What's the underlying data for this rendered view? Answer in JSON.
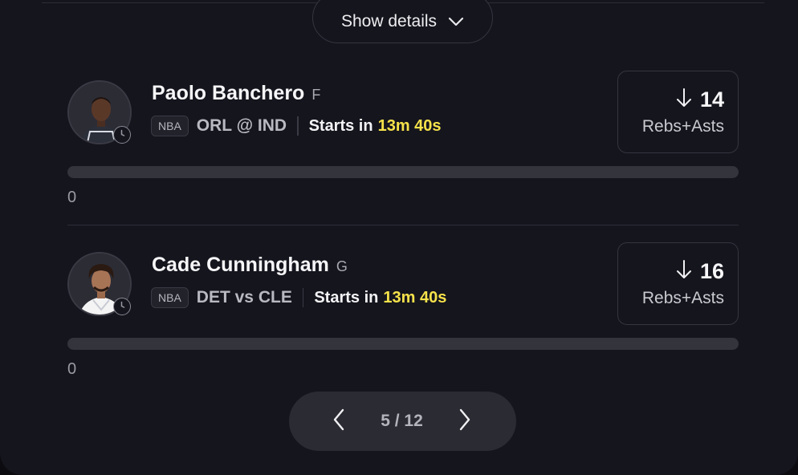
{
  "header": {
    "details_label": "Show details"
  },
  "players": [
    {
      "name": "Paolo Banchero",
      "position": "F",
      "league": "NBA",
      "matchup": "ORL @ IND",
      "starts_label": "Starts in",
      "countdown": "13m 40s",
      "line_value": "14",
      "line_direction": "down-arrow-icon",
      "stat": "Rebs+Asts",
      "current": "0",
      "progress_fraction": 0,
      "jersey_color": "#2a2f3a"
    },
    {
      "name": "Cade Cunningham",
      "position": "G",
      "league": "NBA",
      "matchup": "DET vs CLE",
      "starts_label": "Starts in",
      "countdown": "13m 40s",
      "line_value": "16",
      "line_direction": "down-arrow-icon",
      "stat": "Rebs+Asts",
      "current": "0",
      "progress_fraction": 0,
      "jersey_color": "#f4f4f4"
    }
  ],
  "pagination": {
    "indicator": "5 / 12"
  },
  "colors": {
    "accent_timer": "#f6e24a",
    "card_bg": "#15151e"
  }
}
